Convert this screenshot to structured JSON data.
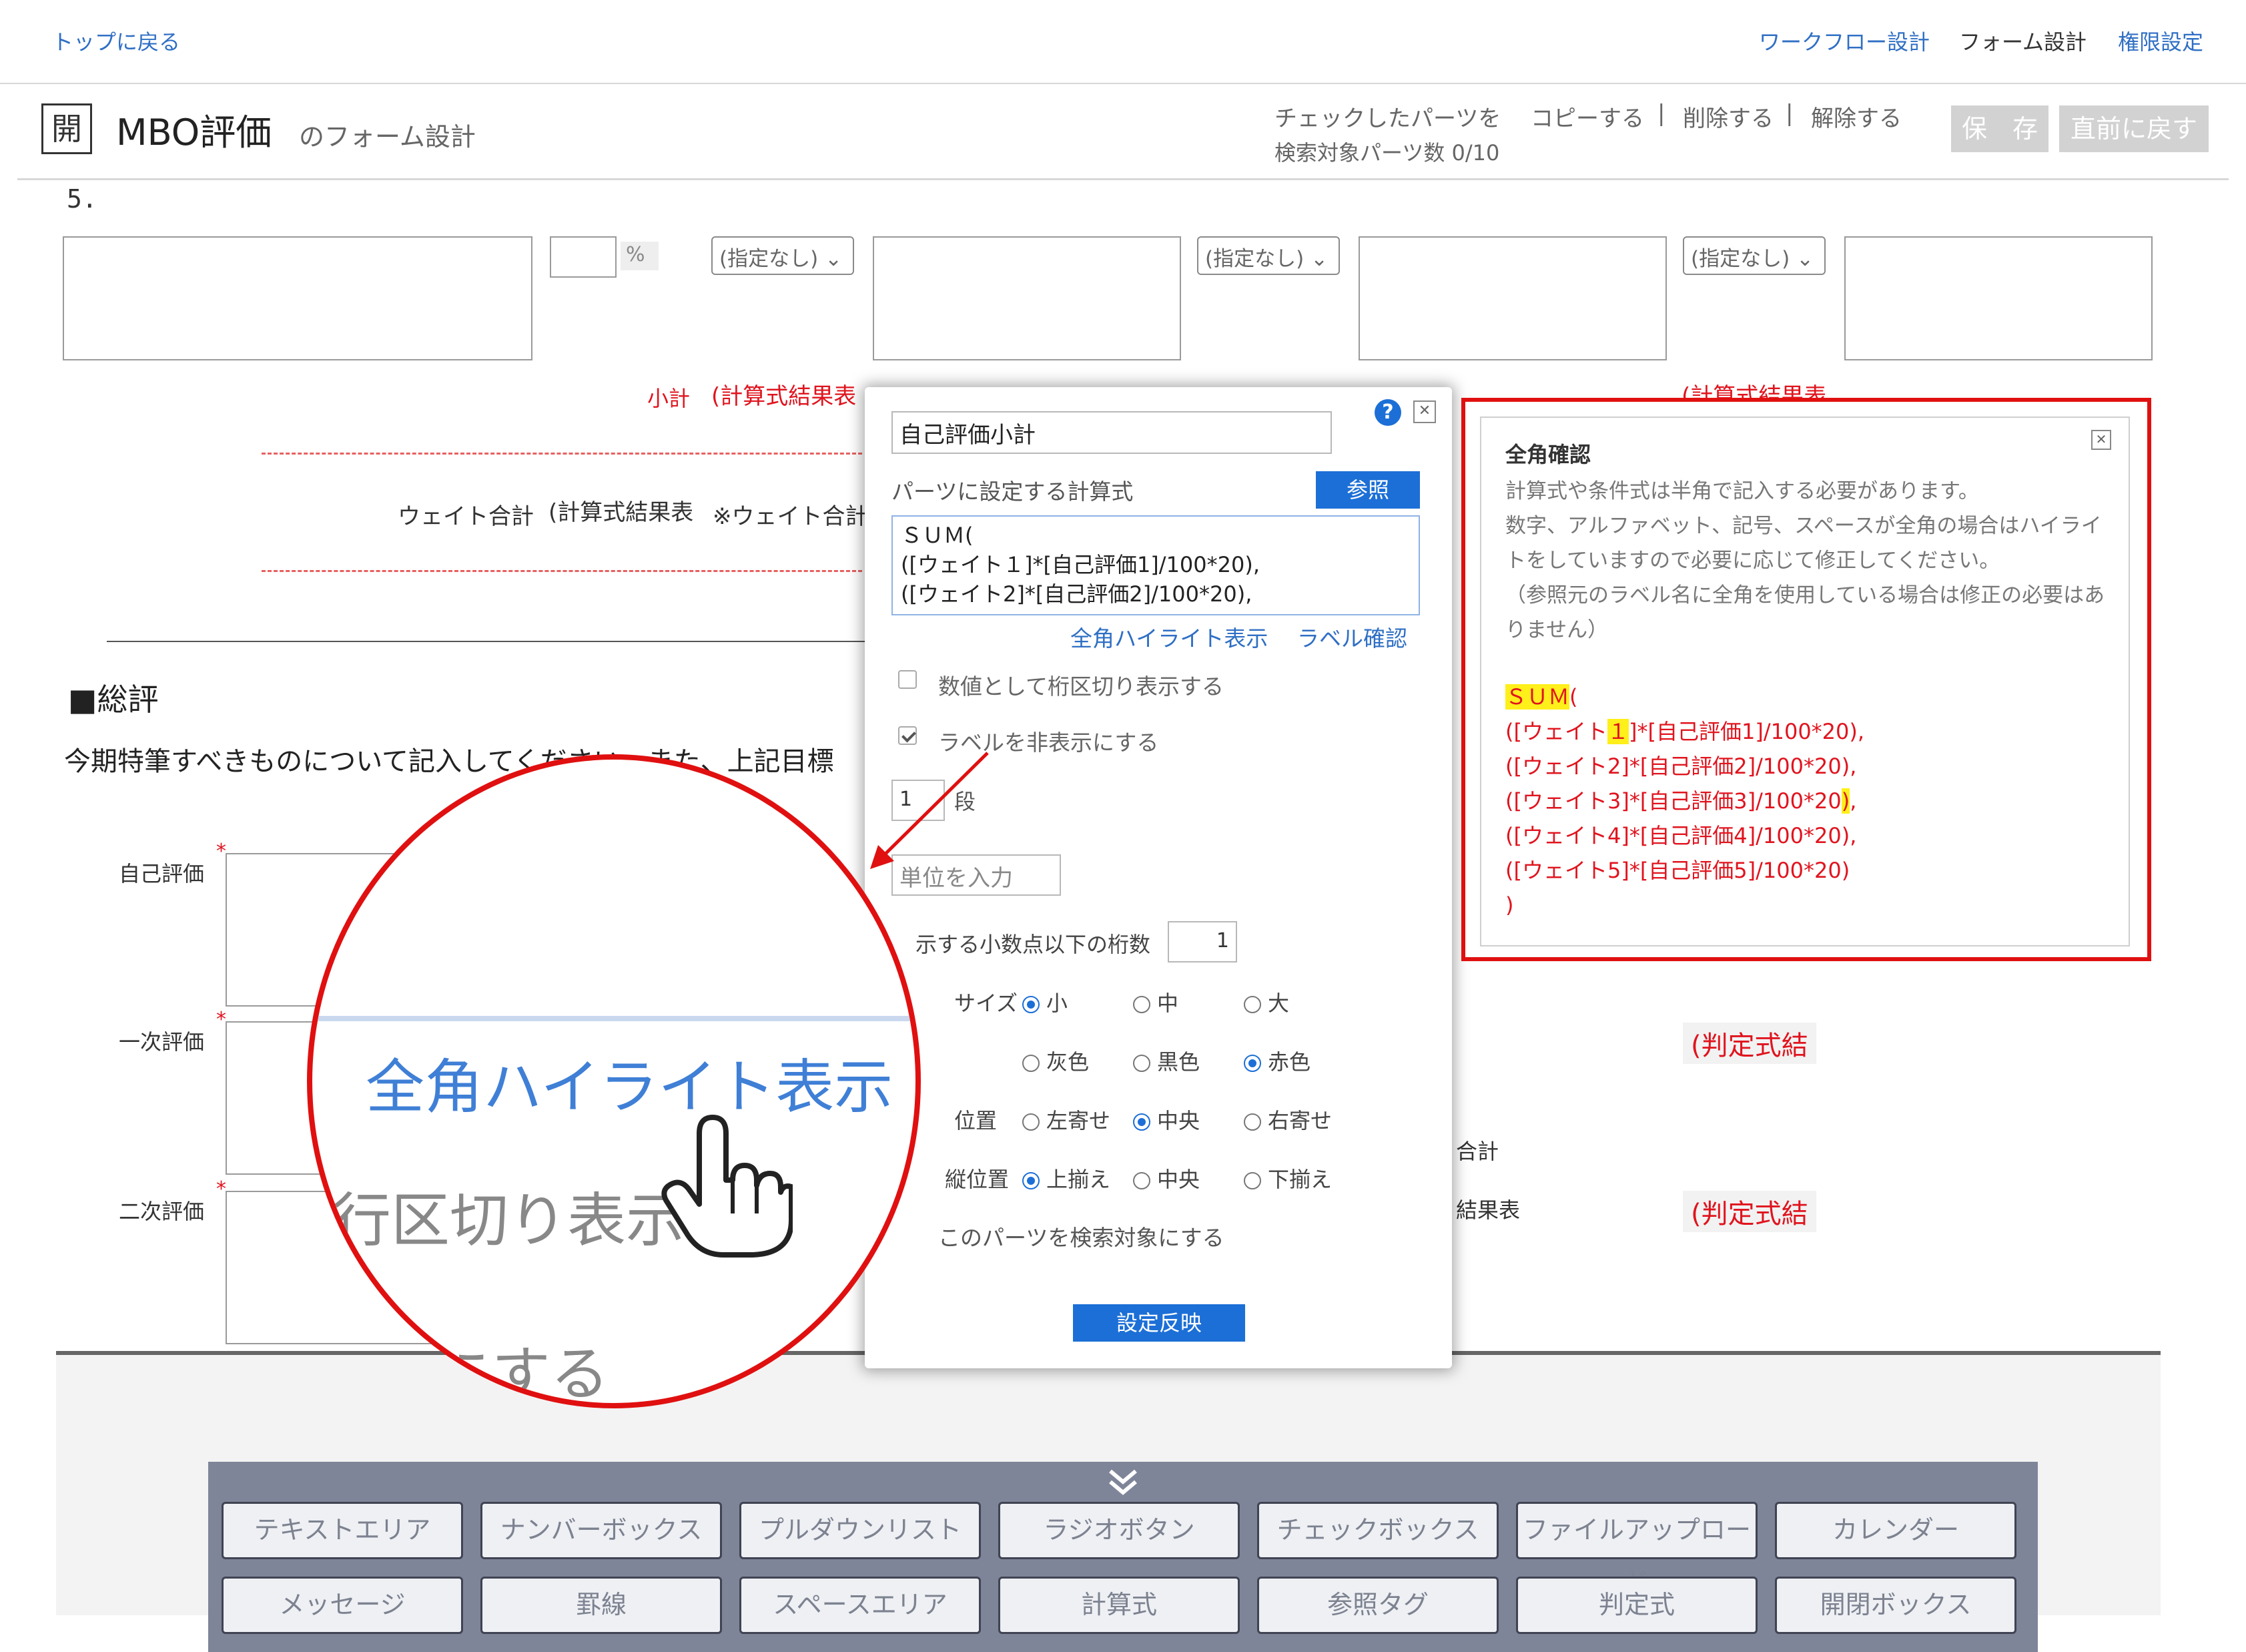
{
  "nav": {
    "back": "トップに戻る",
    "workflow": "ワークフロー設計",
    "form": "フォーム設計",
    "permission": "権限設定"
  },
  "header": {
    "badge": "開",
    "title": "MBO評価",
    "subtitle": "のフォーム設計",
    "checked_parts": "チェックしたパーツを",
    "copy": "コピーする",
    "sep": "|",
    "delete": "削除する",
    "release": "解除する",
    "search_count": "検索対象パーツ数 0/10",
    "save": "保　存",
    "revert": "直前に戻す"
  },
  "form": {
    "section_no": "5.",
    "percent": "%",
    "select_none": "(指定なし)",
    "subtotal": "小計",
    "calc_result": "(計算式結果表",
    "calc_result_full": "(計算式結果表",
    "weight_total": "ウェイト合計",
    "weight_note": "※ウェイト合計",
    "summary_title": "■総評",
    "summary_desc": "今期特筆すべきものについて記入してください。また、上記目標",
    "self_eval": "自己評価",
    "first_eval": "一次評価",
    "second_eval": "二次評価",
    "required": "*",
    "judge_result": "(判定式結",
    "right_total": "合計",
    "right_result": "結果表"
  },
  "panel": {
    "help_icon": "?",
    "close_icon": "✕",
    "name": "自己評価小計",
    "formula_label": "パーツに設定する計算式",
    "ref_button": "参照",
    "formula_lines": [
      "ＳＵＭ(",
      "([ウェイト１]*[自己評価1]/100*20),",
      "([ウェイト2]*[自己評価2]/100*20),"
    ],
    "zenkaku_link": "全角ハイライト表示",
    "label_link": "ラベル確認",
    "num_separator": "数値として桁区切り表示する",
    "hide_label": "ラベルを非表示にする",
    "columns_value": "1",
    "columns_unit": "段",
    "unit_placeholder": "単位を入力",
    "decimal_label": "示する小数点以下の桁数",
    "decimal_value": "1",
    "size_label": "サイズ",
    "size_options": [
      "小",
      "中",
      "大"
    ],
    "color_options": [
      "灰色",
      "黒色",
      "赤色"
    ],
    "hpos_label": "位置",
    "hpos_options": [
      "左寄せ",
      "中央",
      "右寄せ"
    ],
    "vpos_label": "縦位置",
    "vpos_options": [
      "上揃え",
      "中央",
      "下揃え"
    ],
    "search_target": "このパーツを検索対象にする",
    "apply": "設定反映"
  },
  "zenkaku": {
    "title": "全角確認",
    "close_icon": "✕",
    "desc1": "計算式や条件式は半角で記入する必要があります。",
    "desc2": "数字、アルファベット、記号、スペースが全角の場合はハイライ",
    "desc3": "トをしていますので必要に応じて修正してください。",
    "desc4": "（参照元のラベル名に全角を使用している場合は修正の必要はあ",
    "desc5": "りません）",
    "l1_hl": "ＳＵＭ",
    "l1_rest": "(",
    "l2_a": "([ウェイト",
    "l2_hl": "１",
    "l2_b": "]*[自己評価1]/100*20),",
    "l3": "([ウェイト2]*[自己評価2]/100*20),",
    "l4_a": "([ウェイト3]*[自己評価3]/100*20",
    "l4_hl": ")",
    "l4_b": ",",
    "l5": "([ウェイト4]*[自己評価4]/100*20),",
    "l6": "([ウェイト5]*[自己評価5]/100*20)",
    "l7": ")"
  },
  "magnifier": {
    "link": "全角ハイライト表示",
    "behind1": "行区切り表示",
    "behind2": "にする"
  },
  "palette": {
    "toggle_icon": "chevron-double-down-icon",
    "row1": [
      "テキストエリア",
      "ナンバーボックス",
      "プルダウンリスト",
      "ラジオボタン",
      "チェックボックス",
      "ファイルアップロード",
      "カレンダー"
    ],
    "row2": [
      "メッセージ",
      "罫線",
      "スペースエリア",
      "計算式",
      "参照タグ",
      "判定式",
      "開閉ボックス"
    ]
  },
  "colors": {
    "accent": "#1c6fd6",
    "highlight": "#ffef1a",
    "alert": "#e01010"
  }
}
